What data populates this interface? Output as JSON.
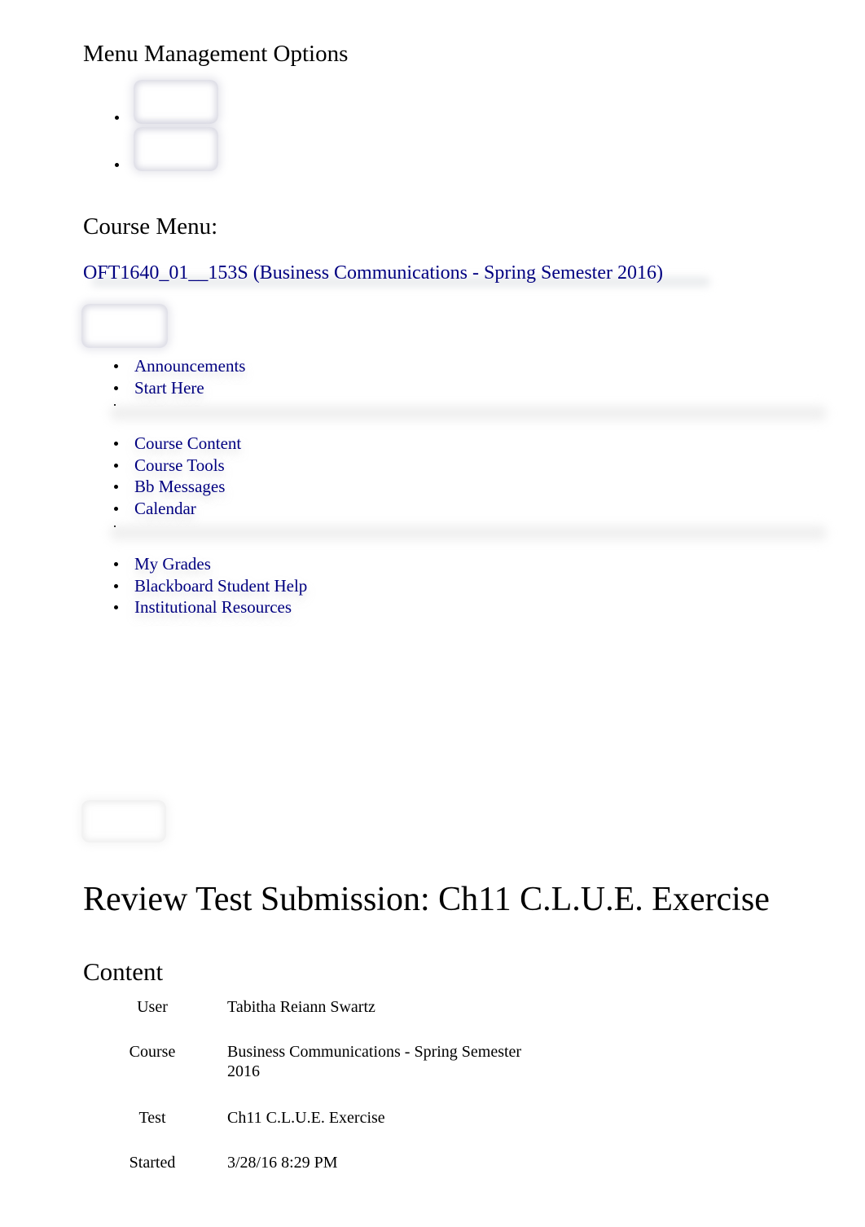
{
  "menu_management": {
    "heading": "Menu Management Options",
    "options_count": 2
  },
  "course_menu": {
    "heading": "Course Menu:",
    "course_link": "OFT1640_01__153S (Business Communications - Spring Semester 2016)",
    "link_color": "#000080",
    "groups": [
      {
        "items": [
          {
            "label": "Announcements"
          },
          {
            "label": "Start Here"
          }
        ]
      },
      {
        "items": [
          {
            "label": "Course Content"
          },
          {
            "label": "Course Tools"
          },
          {
            "label": "Bb Messages"
          },
          {
            "label": "Calendar"
          }
        ]
      },
      {
        "items": [
          {
            "label": "My Grades"
          },
          {
            "label": "Blackboard Student Help"
          },
          {
            "label": "Institutional Resources"
          }
        ]
      }
    ]
  },
  "main": {
    "title": "Review Test Submission: Ch11 C.L.U.E. Exercise",
    "content_heading": "Content",
    "details": [
      {
        "label": "User",
        "value": "Tabitha Reiann Swartz"
      },
      {
        "label": "Course",
        "value": "Business Communications - Spring Semester 2016"
      },
      {
        "label": "Test",
        "value": "Ch11 C.L.U.E. Exercise"
      },
      {
        "label": "Started",
        "value": "3/28/16 8:29 PM"
      }
    ]
  }
}
